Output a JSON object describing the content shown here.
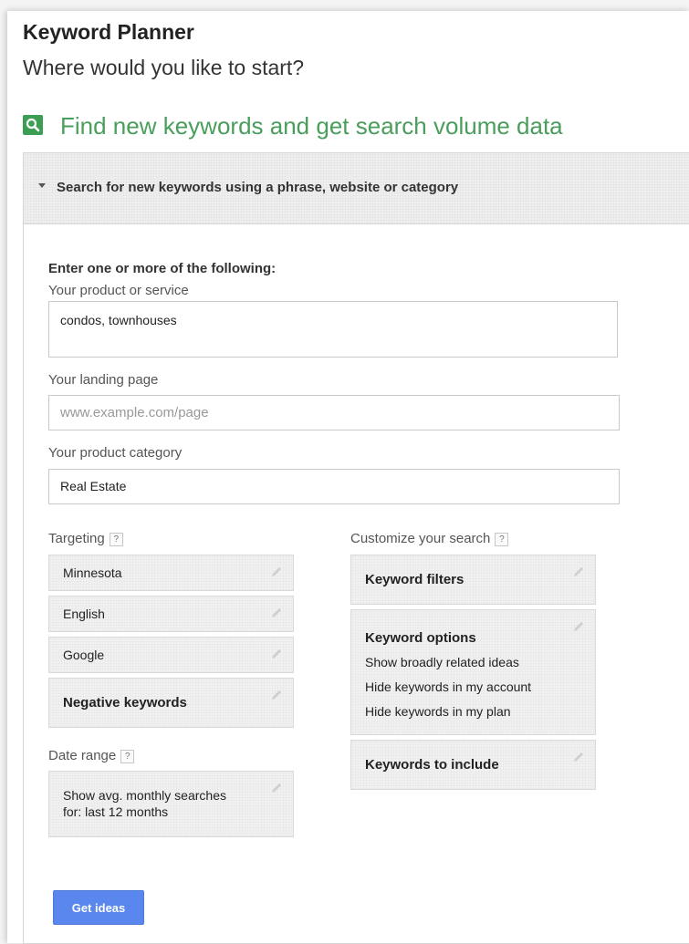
{
  "header": {
    "title": "Keyword Planner",
    "subtitle": "Where would you like to start?"
  },
  "section": {
    "icon": "search-icon",
    "title": "Find new keywords and get search volume data",
    "accent_color": "#4a9e5c"
  },
  "panel": {
    "header_label": "Search for new keywords using a phrase, website or category",
    "intro": "Enter one or more of the following:",
    "product_label": "Your product or service",
    "product_value": "condos, townhouses",
    "landing_label": "Your landing page",
    "landing_placeholder": "www.example.com/page",
    "category_label": "Your product category",
    "category_value": "Real Estate"
  },
  "targeting": {
    "label": "Targeting",
    "help": "?",
    "items": [
      "Minnesota",
      "English",
      "Google"
    ],
    "negative": "Negative keywords"
  },
  "date_range": {
    "label": "Date range",
    "help": "?",
    "line1": "Show avg. monthly searches",
    "line2": "for: last 12 months"
  },
  "customize": {
    "label": "Customize your search",
    "help": "?",
    "filters": "Keyword filters",
    "options_title": "Keyword options",
    "options": [
      "Show broadly related ideas",
      "Hide keywords in my account",
      "Hide keywords in my plan"
    ],
    "include": "Keywords to include"
  },
  "actions": {
    "get_ideas": "Get ideas",
    "button_color": "#5a87ee"
  }
}
